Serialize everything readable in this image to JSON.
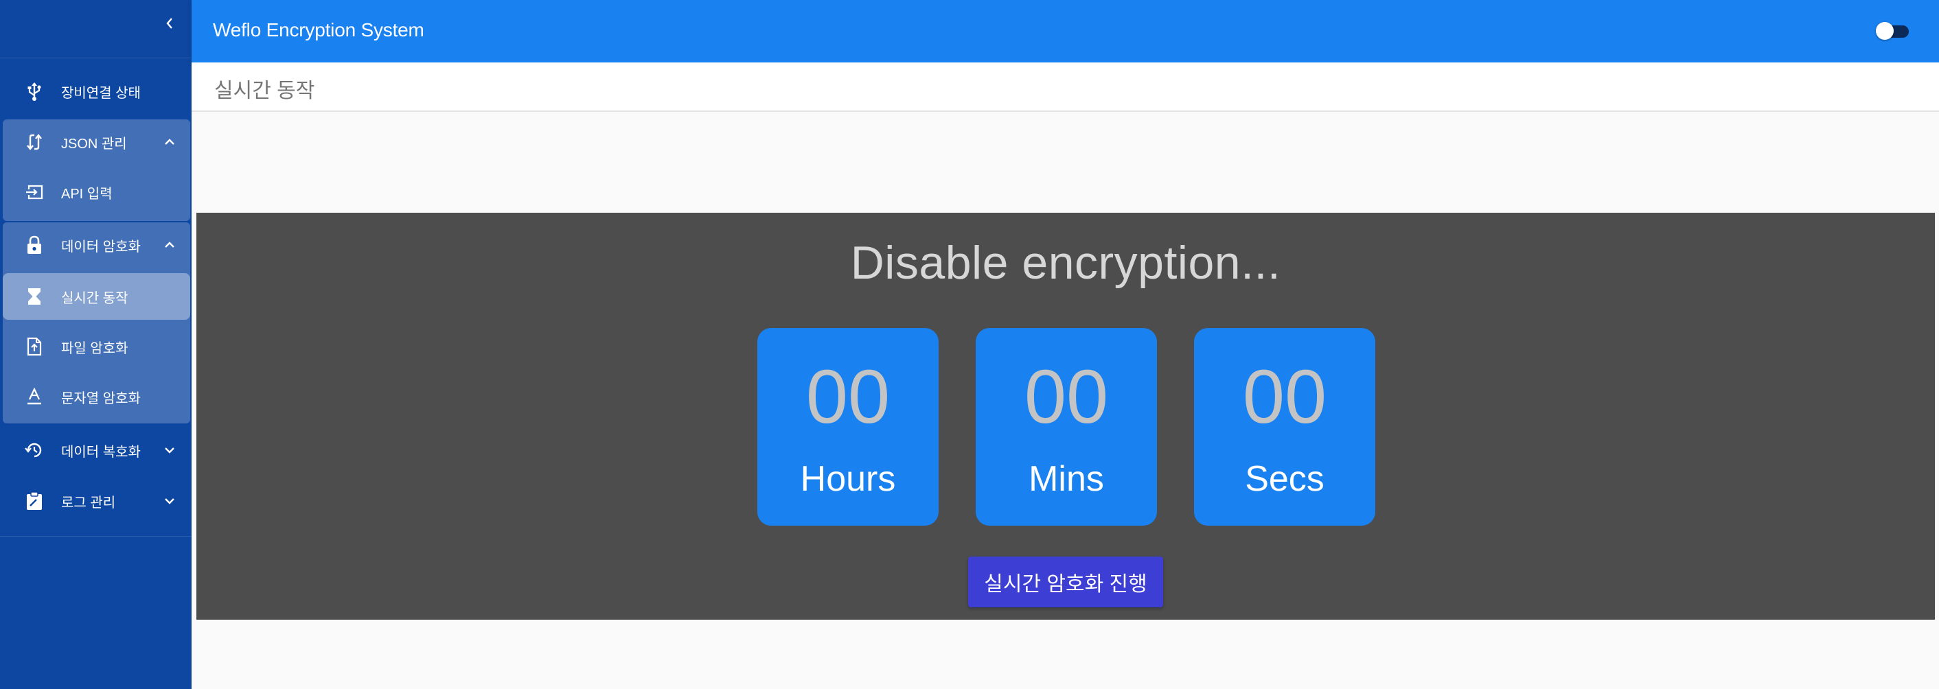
{
  "app": {
    "title": "Weflo Encryption System"
  },
  "breadcrumb": "실시간 동작",
  "sidebar": {
    "items": [
      {
        "label": "장비연결 상태",
        "icon": "usb-icon"
      },
      {
        "label": "JSON 관리",
        "icon": "swap-arrows-icon",
        "expanded": true
      },
      {
        "label": "API 입력",
        "icon": "login-icon"
      },
      {
        "label": "데이터 암호화",
        "icon": "lock-icon",
        "expanded": true
      },
      {
        "label": "실시간 동작",
        "icon": "hourglass-icon",
        "active": true
      },
      {
        "label": "파일 암호화",
        "icon": "file-upload-icon"
      },
      {
        "label": "문자열 암호화",
        "icon": "text-format-icon"
      },
      {
        "label": "데이터 복호화",
        "icon": "restore-icon",
        "expanded": false
      },
      {
        "label": "로그 관리",
        "icon": "clipboard-icon",
        "expanded": false
      }
    ]
  },
  "main": {
    "heading": "Disable encryption...",
    "timer": [
      {
        "value": "00",
        "label": "Hours"
      },
      {
        "value": "00",
        "label": "Mins"
      },
      {
        "value": "00",
        "label": "Secs"
      }
    ],
    "button_label": "실시간 암호화 진행"
  },
  "colors": {
    "sidebar": "#0d47a1",
    "topbar": "#1a82f0",
    "panel": "#4d4d4d",
    "tile": "#1a82f0",
    "button": "#3d3fd4"
  }
}
